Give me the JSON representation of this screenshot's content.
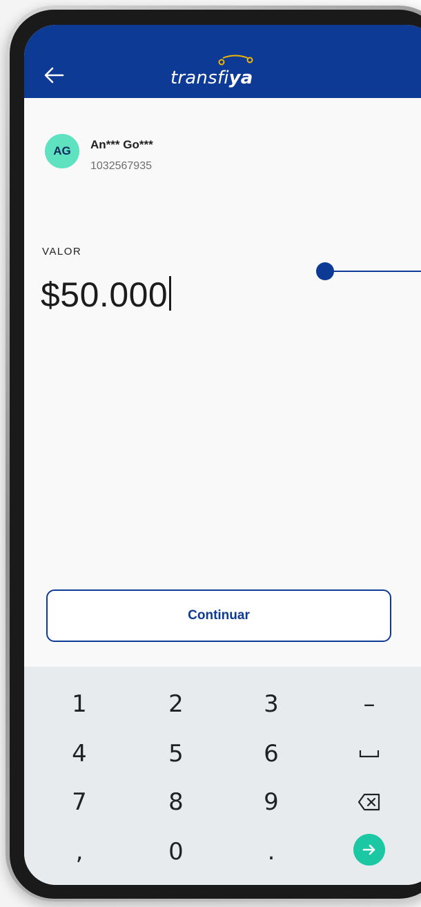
{
  "header": {
    "logo_prefix": "transfi",
    "logo_suffix": "ya"
  },
  "recipient": {
    "initials": "AG",
    "name": "An*** Go***",
    "id": "1032567935"
  },
  "amount": {
    "label": "VALOR",
    "value": "$50.000"
  },
  "continue_label": "Continuar",
  "keypad": {
    "keys": [
      "1",
      "2",
      "3",
      "–",
      "4",
      "5",
      "6",
      "␣",
      "7",
      "8",
      "9",
      "⌫",
      ",",
      "0",
      "."
    ]
  },
  "colors": {
    "brand_blue": "#0c3a94",
    "accent_teal": "#1cc7a4",
    "avatar_mint": "#5ee2c0"
  }
}
